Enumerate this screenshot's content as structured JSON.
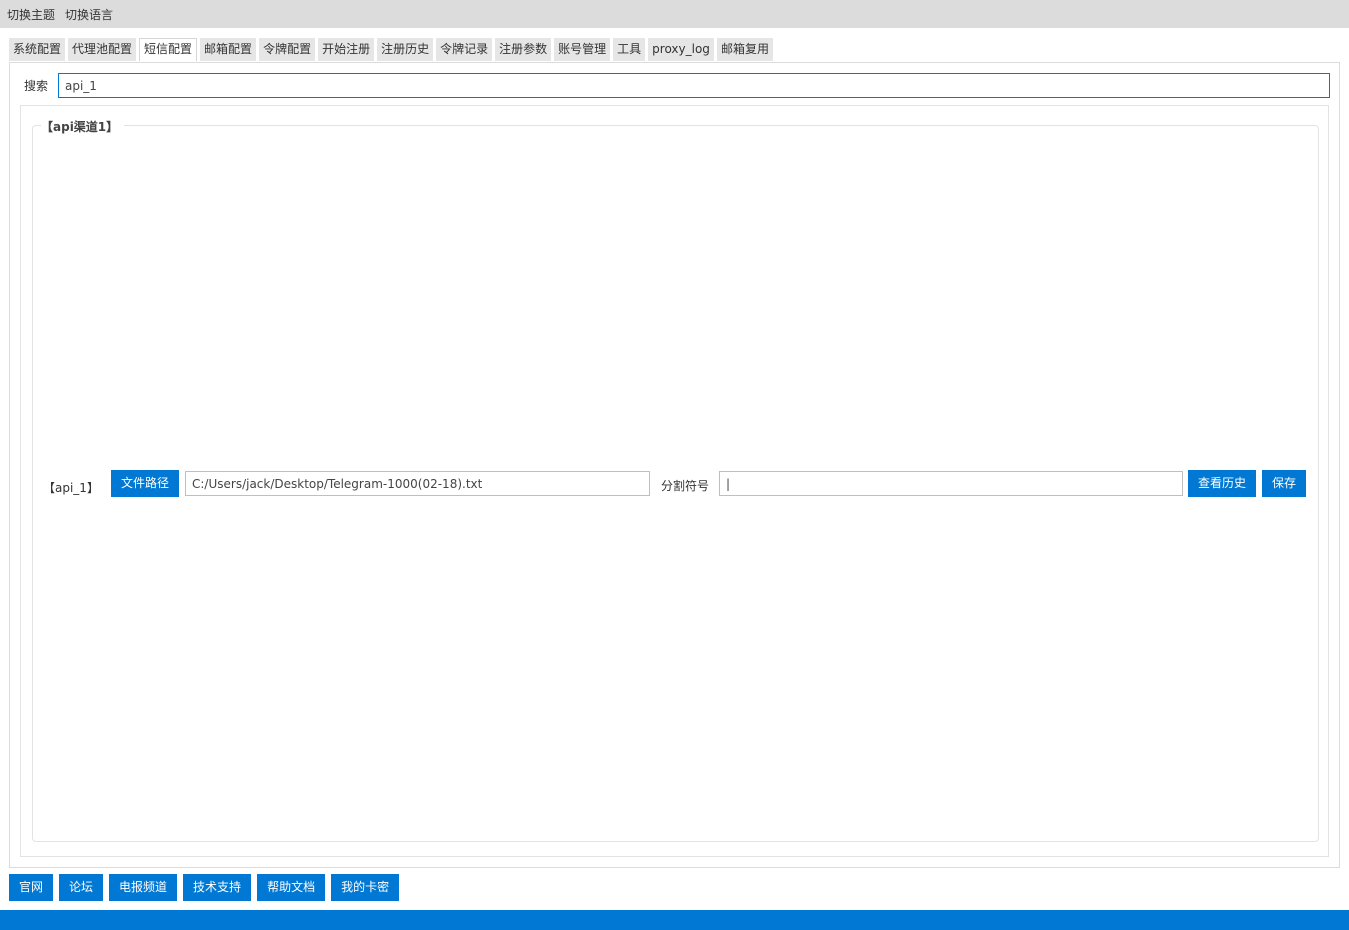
{
  "menubar": {
    "items": [
      "切换主题",
      "切换语言"
    ]
  },
  "tabs": {
    "items": [
      "系统配置",
      "代理池配置",
      "短信配置",
      "邮箱配置",
      "令牌配置",
      "开始注册",
      "注册历史",
      "令牌记录",
      "注册参数",
      "账号管理",
      "工具",
      "proxy_log",
      "邮箱复用"
    ],
    "active": "短信配置"
  },
  "search": {
    "label": "搜索",
    "value": "api_1"
  },
  "group": {
    "title": "【api渠道1】",
    "row": {
      "label": "【api_1】",
      "file_path_button": "文件路径",
      "file_path_value": "C:/Users/jack/Desktop/Telegram-1000(02-18).txt",
      "separator_label": "分割符号",
      "separator_value": "|",
      "history_button": "查看历史",
      "save_button": "保存"
    }
  },
  "footer": {
    "buttons": [
      "官网",
      "论坛",
      "电报频道",
      "技术支持",
      "帮助文档",
      "我的卡密"
    ]
  },
  "colors": {
    "accent": "#0078d4",
    "menubar_bg": "#dcdcdc"
  }
}
